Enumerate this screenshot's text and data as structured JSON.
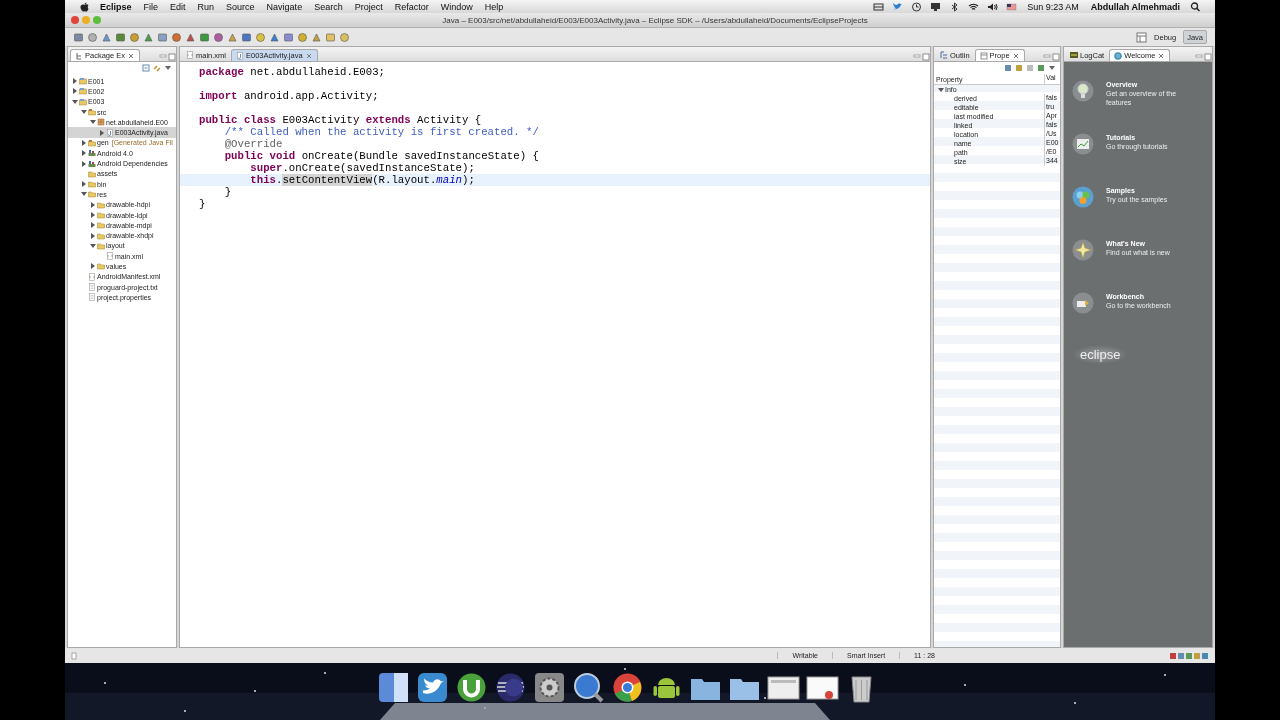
{
  "menu_bar": {
    "app": "Eclipse",
    "items": [
      "File",
      "Edit",
      "Run",
      "Source",
      "Navigate",
      "Search",
      "Project",
      "Refactor",
      "Window",
      "Help"
    ],
    "clock": "Sun 9:23 AM",
    "user": "Abdullah Almehmadi"
  },
  "window": {
    "title": "Java – E003/src/net/abdullaheid/E003/E003Activity.java – Eclipse SDK – /Users/abdullaheid/Documents/EclipseProjects"
  },
  "perspectives": [
    {
      "label": "Debug",
      "selected": false
    },
    {
      "label": "Java",
      "selected": true
    }
  ],
  "package_explorer": {
    "tab": "Package Ex",
    "tree": [
      {
        "label": "E001",
        "kind": "project",
        "expanded": false,
        "selected": false
      },
      {
        "label": "E002",
        "kind": "project",
        "expanded": false,
        "selected": false
      },
      {
        "label": "E003",
        "kind": "project",
        "expanded": true,
        "selected": false,
        "children": [
          {
            "label": "src",
            "kind": "source",
            "expanded": true,
            "selected": false,
            "children": [
              {
                "label": "net.abdullaheid.E00",
                "kind": "package",
                "expanded": true,
                "selected": false,
                "children": [
                  {
                    "label": "E003Activity.java",
                    "kind": "java",
                    "expanded": false,
                    "selected": true
                  }
                ]
              }
            ]
          },
          {
            "label": "gen",
            "decoration": "[Generated Java Fil",
            "kind": "source",
            "expanded": false,
            "selected": false
          },
          {
            "label": "Android 4.0",
            "kind": "library",
            "expanded": false,
            "selected": false
          },
          {
            "label": "Android Dependencies",
            "kind": "library",
            "expanded": false,
            "selected": false
          },
          {
            "label": "assets",
            "kind": "folder",
            "selected": false
          },
          {
            "label": "bin",
            "kind": "folder",
            "expanded": false,
            "selected": false
          },
          {
            "label": "res",
            "kind": "folder",
            "expanded": true,
            "selected": false,
            "children": [
              {
                "label": "drawable-hdpi",
                "kind": "folder",
                "expanded": false,
                "selected": false
              },
              {
                "label": "drawable-ldpi",
                "kind": "folder",
                "expanded": false,
                "selected": false
              },
              {
                "label": "drawable-mdpi",
                "kind": "folder",
                "expanded": false,
                "selected": false
              },
              {
                "label": "drawable-xhdpi",
                "kind": "folder",
                "expanded": false,
                "selected": false
              },
              {
                "label": "layout",
                "kind": "folder",
                "expanded": true,
                "selected": false,
                "children": [
                  {
                    "label": "main.xml",
                    "kind": "xml",
                    "selected": false
                  }
                ]
              },
              {
                "label": "values",
                "kind": "folder",
                "expanded": false,
                "selected": false
              }
            ]
          },
          {
            "label": "AndroidManifest.xml",
            "kind": "xml",
            "selected": false
          },
          {
            "label": "proguard-project.txt",
            "kind": "file",
            "selected": false
          },
          {
            "label": "project.properties",
            "kind": "file",
            "selected": false
          }
        ]
      }
    ]
  },
  "editor": {
    "tabs": [
      {
        "label": "main.xml",
        "selected": false
      },
      {
        "label": "E003Activity.java",
        "selected": true
      }
    ],
    "code_blocks": [
      [
        {
          "current": false,
          "tokens": [
            {
              "kind": "keyword",
              "text": "package"
            },
            {
              "kind": "plain",
              "text": " net.abdullaheid.E003;"
            }
          ]
        }
      ],
      [
        {
          "current": false,
          "tokens": [
            {
              "kind": "keyword",
              "text": "import"
            },
            {
              "kind": "plain",
              "text": " android.app.Activity;"
            }
          ]
        }
      ],
      [
        {
          "current": false,
          "tokens": [
            {
              "kind": "keyword",
              "text": "public class"
            },
            {
              "kind": "plain",
              "text": " E003Activity "
            },
            {
              "kind": "keyword",
              "text": "extends"
            },
            {
              "kind": "plain",
              "text": " Activity {"
            }
          ]
        },
        {
          "current": false,
          "tokens": [
            {
              "kind": "comment",
              "text": "    /** Called when the activity is first created. */"
            }
          ]
        },
        {
          "current": false,
          "tokens": [
            {
              "kind": "annotation",
              "text": "    @Override"
            }
          ]
        },
        {
          "current": false,
          "tokens": [
            {
              "kind": "keyword",
              "text": "    public void"
            },
            {
              "kind": "plain",
              "text": " onCreate(Bundle savedInstanceState) {"
            }
          ]
        },
        {
          "current": false,
          "tokens": [
            {
              "kind": "keyword",
              "text": "        super"
            },
            {
              "kind": "plain",
              "text": ".onCreate(savedInstanceState);"
            }
          ]
        },
        {
          "current": true,
          "tokens": [
            {
              "kind": "keyword",
              "text": "        this"
            },
            {
              "kind": "plain",
              "text": "."
            },
            {
              "kind": "occurrence",
              "text": "setContentView"
            },
            {
              "kind": "plain",
              "text": "(R.layout."
            },
            {
              "kind": "field",
              "text": "main"
            },
            {
              "kind": "plain",
              "text": ");"
            }
          ]
        },
        {
          "current": false,
          "tokens": [
            {
              "kind": "plain",
              "text": "    }"
            }
          ]
        },
        {
          "current": false,
          "tokens": [
            {
              "kind": "plain",
              "text": "}"
            }
          ]
        }
      ]
    ]
  },
  "properties": {
    "tabs": [
      {
        "label": "Outlin",
        "selected": false
      },
      {
        "label": "Prope",
        "selected": true
      }
    ],
    "columns": [
      "Property",
      "Val"
    ],
    "group": {
      "label": "Info",
      "expanded": true,
      "rows": [
        {
          "name": "derived",
          "value": "fals"
        },
        {
          "name": "editable",
          "value": "tru"
        },
        {
          "name": "last modified",
          "value": "Apr"
        },
        {
          "name": "linked",
          "value": "fals"
        },
        {
          "name": "location",
          "value": "/Us"
        },
        {
          "name": "name",
          "value": "E00"
        },
        {
          "name": "path",
          "value": "/E0"
        },
        {
          "name": "size",
          "value": "344"
        }
      ]
    }
  },
  "welcome": {
    "tabs": [
      {
        "label": "LogCat",
        "selected": false
      },
      {
        "label": "Welcome",
        "selected": true
      }
    ],
    "items": [
      {
        "kind": "overview",
        "title": "Overview",
        "description": "Get an overview of the features"
      },
      {
        "kind": "tutorials",
        "title": "Tutorials",
        "description": "Go through tutorials"
      },
      {
        "kind": "samples",
        "title": "Samples",
        "description": "Try out the samples"
      },
      {
        "kind": "whatsnew",
        "title": "What's New",
        "description": "Find out what is new"
      },
      {
        "kind": "workbench",
        "title": "Workbench",
        "description": "Go to the workbench"
      }
    ],
    "logo": "eclipse"
  },
  "status_bar": {
    "mode": "Writable",
    "insert": "Smart Insert",
    "position": "11 : 28"
  }
}
